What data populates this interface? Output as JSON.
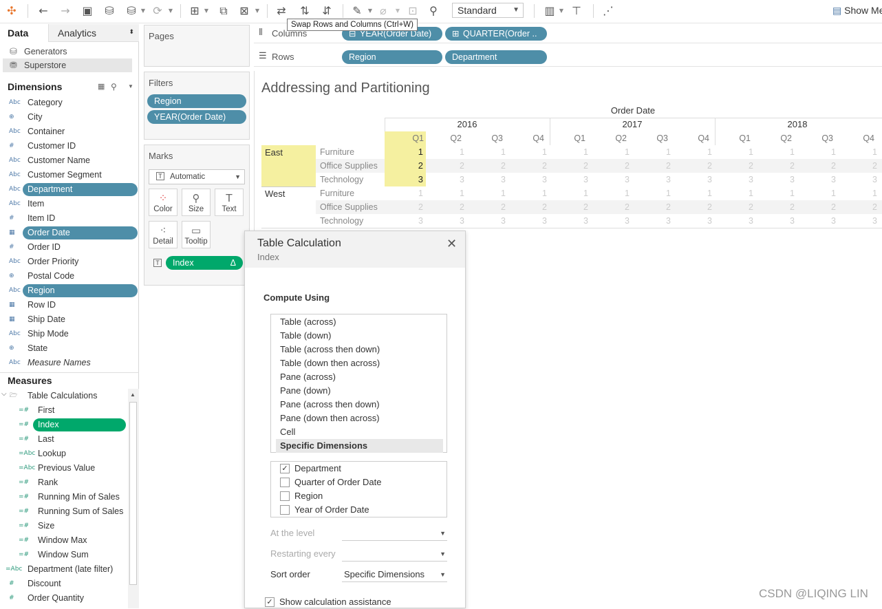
{
  "toolbar": {
    "view_mode": "Standard",
    "show_me_label": "Show Me",
    "tooltip": "Swap Rows and Columns (Ctrl+W)"
  },
  "left_pane": {
    "tabs": [
      "Data",
      "Analytics"
    ],
    "datasources": [
      {
        "label": "Generators",
        "icon": "cylinder-icon"
      },
      {
        "label": "Superstore",
        "icon": "datasource-icon",
        "selected": true
      }
    ],
    "dimensions_header": "Dimensions",
    "dimensions": [
      {
        "label": "Category",
        "type": "Abc",
        "pill": false
      },
      {
        "label": "City",
        "type": "globe",
        "pill": false
      },
      {
        "label": "Container",
        "type": "Abc",
        "pill": false
      },
      {
        "label": "Customer ID",
        "type": "#",
        "pill": false
      },
      {
        "label": "Customer Name",
        "type": "Abc",
        "pill": false
      },
      {
        "label": "Customer Segment",
        "type": "Abc",
        "pill": false
      },
      {
        "label": "Department",
        "type": "Abc",
        "pill": true
      },
      {
        "label": "Item",
        "type": "Abc",
        "pill": false
      },
      {
        "label": "Item ID",
        "type": "#",
        "pill": false
      },
      {
        "label": "Order Date",
        "type": "date",
        "pill": true
      },
      {
        "label": "Order ID",
        "type": "#",
        "pill": false
      },
      {
        "label": "Order Priority",
        "type": "Abc",
        "pill": false
      },
      {
        "label": "Postal Code",
        "type": "globe",
        "pill": false
      },
      {
        "label": "Region",
        "type": "Abc",
        "pill": true
      },
      {
        "label": "Row ID",
        "type": "date",
        "pill": false
      },
      {
        "label": "Ship Date",
        "type": "date",
        "pill": false
      },
      {
        "label": "Ship Mode",
        "type": "Abc",
        "pill": false
      },
      {
        "label": "State",
        "type": "globe",
        "pill": false
      },
      {
        "label": "Measure Names",
        "type": "Abc",
        "pill": false,
        "italic": true
      }
    ],
    "measures_header": "Measures",
    "measures": [
      {
        "label": "Table Calculations",
        "type": "folder",
        "pill": false,
        "indent": 0
      },
      {
        "label": "First",
        "type": "=#",
        "pill": false,
        "indent": 1
      },
      {
        "label": "Index",
        "type": "=#",
        "pill": true,
        "indent": 1
      },
      {
        "label": "Last",
        "type": "=#",
        "pill": false,
        "indent": 1
      },
      {
        "label": "Lookup",
        "type": "=Abc",
        "pill": false,
        "indent": 1
      },
      {
        "label": "Previous Value",
        "type": "=Abc",
        "pill": false,
        "indent": 1
      },
      {
        "label": "Rank",
        "type": "=#",
        "pill": false,
        "indent": 1
      },
      {
        "label": "Running Min of Sales",
        "type": "=#",
        "pill": false,
        "indent": 1
      },
      {
        "label": "Running Sum of Sales",
        "type": "=#",
        "pill": false,
        "indent": 1
      },
      {
        "label": "Size",
        "type": "=#",
        "pill": false,
        "indent": 1
      },
      {
        "label": "Window Max",
        "type": "=#",
        "pill": false,
        "indent": 1
      },
      {
        "label": "Window Sum",
        "type": "=#",
        "pill": false,
        "indent": 1
      },
      {
        "label": "Department (late filter)",
        "type": "=Abc",
        "pill": false,
        "indent": 0
      },
      {
        "label": "Discount",
        "type": "#",
        "pill": false,
        "indent": 0
      },
      {
        "label": "Order Quantity",
        "type": "#",
        "pill": false,
        "indent": 0
      }
    ]
  },
  "cards": {
    "pages_title": "Pages",
    "filters_title": "Filters",
    "filters": [
      "Region",
      "YEAR(Order Date)"
    ],
    "marks_title": "Marks",
    "mark_type": "Automatic",
    "mark_buttons": [
      {
        "label": "Color",
        "icon": "color-icon"
      },
      {
        "label": "Size",
        "icon": "size-icon"
      },
      {
        "label": "Text",
        "icon": "text-icon"
      },
      {
        "label": "Detail",
        "icon": "detail-icon"
      },
      {
        "label": "Tooltip",
        "icon": "tooltip-icon"
      }
    ],
    "marks_pill": "Index",
    "marks_pill_delta": "Δ"
  },
  "shelves": {
    "columns_label": "Columns",
    "columns": [
      "YEAR(Order Date)",
      "QUARTER(Order .."
    ],
    "rows_label": "Rows",
    "rows": [
      "Region",
      "Department"
    ]
  },
  "view": {
    "title": "Addressing and Partitioning",
    "column_header": "Order Date",
    "years": [
      "2016",
      "2017",
      "2018"
    ],
    "quarters": [
      "Q1",
      "Q2",
      "Q3",
      "Q4"
    ],
    "regions": [
      "East",
      "West"
    ],
    "departments": [
      "Furniture",
      "Office Supplies",
      "Technology"
    ],
    "values": [
      1,
      2,
      3
    ],
    "highlight_color": "#f5f0a0"
  },
  "dialog": {
    "title": "Table Calculation",
    "subtitle": "Index",
    "compute_label": "Compute Using",
    "options": [
      "Table (across)",
      "Table (down)",
      "Table (across then down)",
      "Table (down then across)",
      "Pane (across)",
      "Pane (down)",
      "Pane (across then down)",
      "Pane (down then across)",
      "Cell",
      "Specific Dimensions"
    ],
    "selected_option": "Specific Dimensions",
    "dimensions": [
      {
        "label": "Department",
        "checked": true
      },
      {
        "label": "Quarter of Order Date",
        "checked": false
      },
      {
        "label": "Region",
        "checked": false
      },
      {
        "label": "Year of Order Date",
        "checked": false
      }
    ],
    "at_level_label": "At the level",
    "restart_label": "Restarting every",
    "sort_label": "Sort order",
    "sort_value": "Specific Dimensions",
    "assist_label": "Show calculation assistance",
    "assist_checked": true
  },
  "watermark": "CSDN @LIQING LIN"
}
